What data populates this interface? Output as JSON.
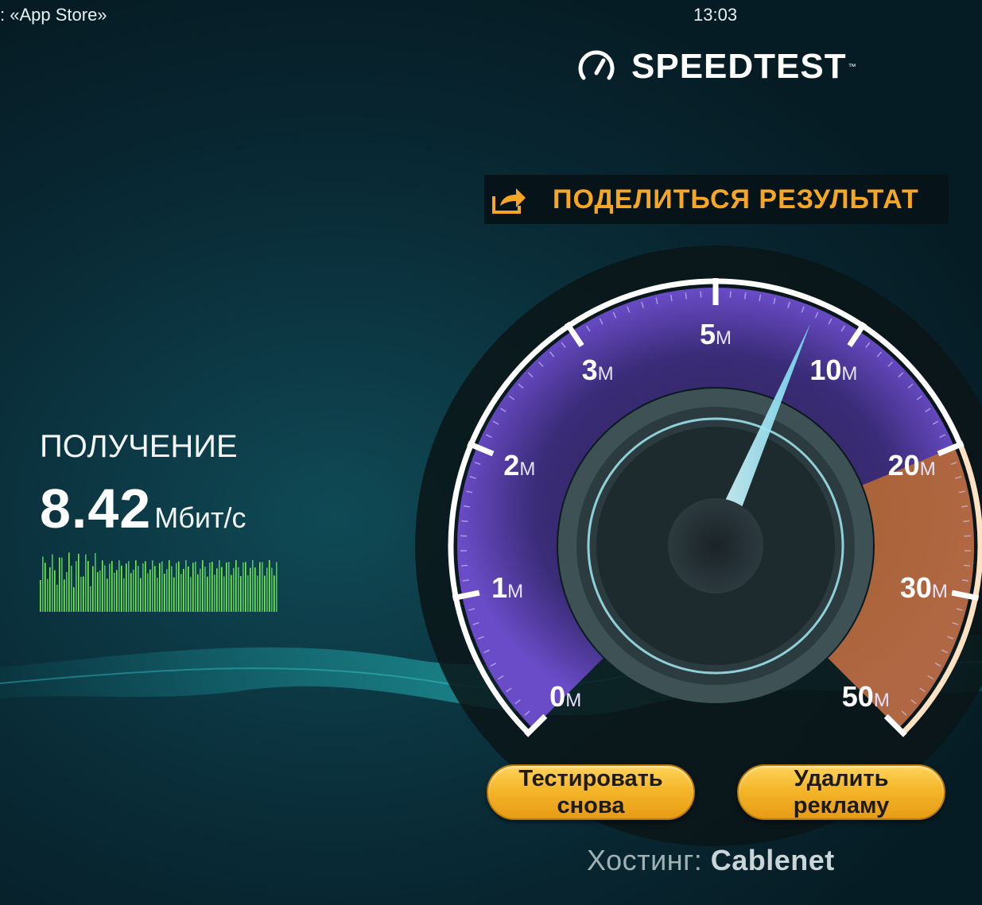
{
  "status_bar": {
    "back_link": ": «App Store»",
    "time": "13:03"
  },
  "app": {
    "logo_text": "SPEEDTEST",
    "trademark": "™"
  },
  "share": {
    "label": "ПОДЕЛИТЬСЯ  РЕЗУЛЬТАТ",
    "icon": "share-icon"
  },
  "download": {
    "label": "ПОЛУЧЕНИЕ",
    "value": "8.42",
    "unit": "Мбит/с"
  },
  "gauge": {
    "ticks": [
      {
        "num": "0",
        "suffix": "M"
      },
      {
        "num": "1",
        "suffix": "M"
      },
      {
        "num": "2",
        "suffix": "M"
      },
      {
        "num": "3",
        "suffix": "M"
      },
      {
        "num": "5",
        "suffix": "M"
      },
      {
        "num": "10",
        "suffix": "M"
      },
      {
        "num": "20",
        "suffix": "M"
      },
      {
        "num": "30",
        "suffix": "M"
      },
      {
        "num": "50",
        "suffix": "M"
      }
    ],
    "needle_value_mbps": 8.42,
    "colors": {
      "arc": "#5b3fb0",
      "arc_high": "#c77a3a",
      "needle": "#8ee9ff"
    }
  },
  "buttons": {
    "retest": {
      "line1": "Тестировать",
      "line2": "снова"
    },
    "remove_ads": {
      "line1": "Удалить",
      "line2": "рекламу"
    }
  },
  "host": {
    "label": "Хостинг:",
    "name": "Cablenet"
  }
}
